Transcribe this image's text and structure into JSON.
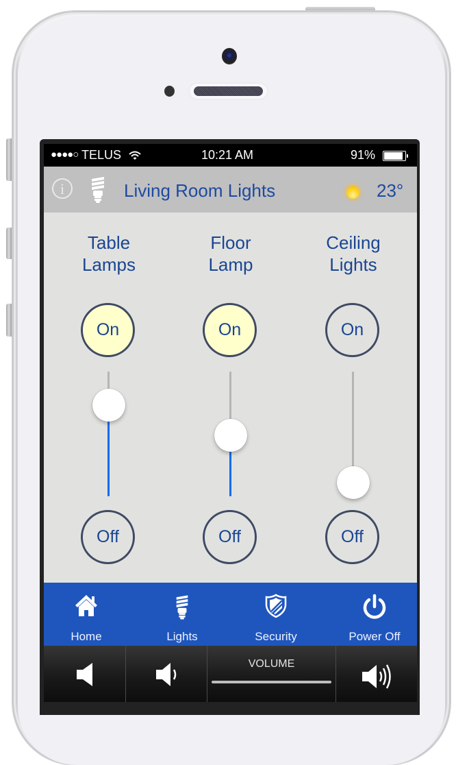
{
  "status_bar": {
    "signal_dots": "●●●●○",
    "carrier": "TELUS",
    "time": "10:21 AM",
    "battery_percent_label": "91%",
    "battery_level": 0.91
  },
  "header": {
    "info_icon": "info-icon",
    "room_icon": "light-bulb-icon",
    "title": "Living Room Lights",
    "weather_icon": "sun-icon",
    "temperature": "23°"
  },
  "lights": [
    {
      "label_line1": "Table",
      "label_line2": "Lamps",
      "on_label": "On",
      "off_label": "Off",
      "is_on": true,
      "level": 0.73
    },
    {
      "label_line1": "Floor",
      "label_line2": "Lamp",
      "on_label": "On",
      "off_label": "Off",
      "is_on": true,
      "level": 0.49
    },
    {
      "label_line1": "Ceiling",
      "label_line2": "Lights",
      "on_label": "On",
      "off_label": "Off",
      "is_on": false,
      "level": 0.11
    }
  ],
  "tabs": [
    {
      "label": "Home",
      "icon": "home-icon"
    },
    {
      "label": "Lights",
      "icon": "light-bulb-icon"
    },
    {
      "label": "Security",
      "icon": "shield-icon"
    },
    {
      "label": "Power Off",
      "icon": "power-icon"
    }
  ],
  "volume": {
    "label": "VOLUME",
    "mute_icon": "speaker-mute-icon",
    "down_icon": "volume-down-icon",
    "up_icon": "volume-up-icon"
  },
  "colors": {
    "accent_blue": "#1f56bd",
    "text_blue": "#1a4592",
    "slider_fill": "#0a6cf0",
    "lit_button": "#ffffcc",
    "header_bg": "#c0c0c0",
    "content_bg": "#e1e2e0"
  }
}
